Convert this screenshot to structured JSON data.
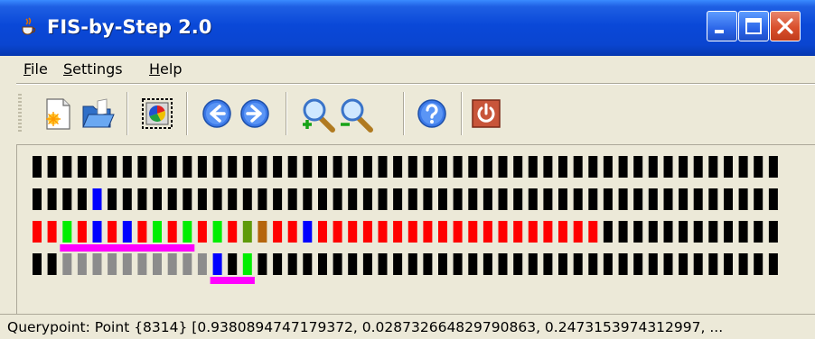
{
  "window": {
    "title": "FIS-by-Step 2.0"
  },
  "menu": {
    "items": [
      "File",
      "Settings",
      "Help"
    ]
  },
  "toolbar": {
    "buttons": [
      {
        "name": "new-button",
        "icon": "new-document-icon"
      },
      {
        "name": "open-button",
        "icon": "open-folder-icon"
      },
      {
        "name": "display-button",
        "icon": "color-wheel-icon"
      },
      {
        "name": "back-button",
        "icon": "arrow-left-icon"
      },
      {
        "name": "forward-button",
        "icon": "arrow-right-icon"
      },
      {
        "name": "zoom-in-button",
        "icon": "zoom-in-icon"
      },
      {
        "name": "zoom-out-button",
        "icon": "zoom-out-icon"
      },
      {
        "name": "help-button",
        "icon": "help-icon"
      },
      {
        "name": "exit-button",
        "icon": "power-icon"
      }
    ]
  },
  "colors": {
    "black": "#000000",
    "red": "#ff0000",
    "green": "#00ee00",
    "blue": "#0000ff",
    "gray": "#8c8c8c",
    "olive": "#5f9a0a",
    "brown": "#b5650c",
    "magenta": "#ff00ff"
  },
  "visualization": {
    "rows": [
      {
        "cells": "kkkkkkkkkkkkkkkkkkkkkkkkkkkkkkkkkkkkkkkkkkkkkkkkkk"
      },
      {
        "cells": "kkkkbkkkkkkkkkkkkkkkkkkkkkkkkkkkkkkkkkkkkkkkkkkkkk"
      },
      {
        "cells": "rrgrbrbrgrgrgrolrrbrrrrrrrrrrrrrrrrrrrkkkkkkkkkkkk",
        "highlight": [
          2,
          10
        ]
      },
      {
        "cells": "kkggggggggggbkgkkkkkkkkkkkkkkkkkkkkkkkkkkkkkkkkkkk",
        "highlight": [
          12,
          14
        ]
      }
    ]
  },
  "status": {
    "text": "Querypoint: Point {8314} [0.9380894747179372, 0.028732664829790863, 0.2473153974312997, ..."
  }
}
